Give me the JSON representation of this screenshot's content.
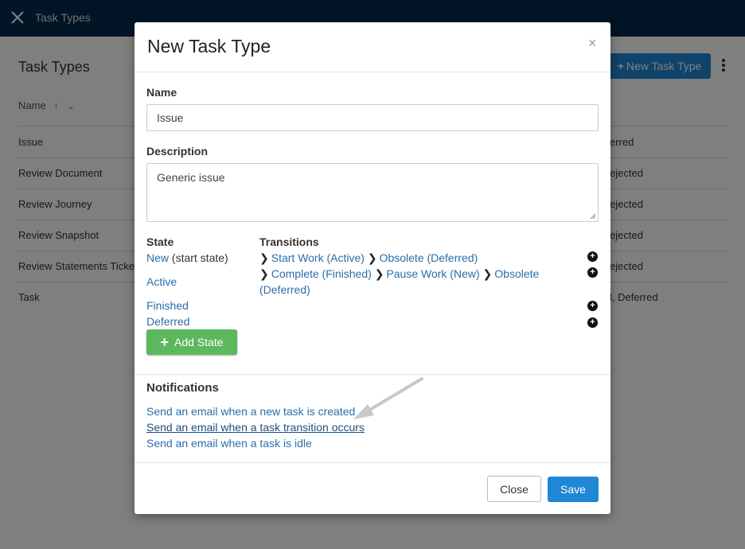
{
  "app": {
    "title": "Task Types",
    "page_title": "Task Types",
    "new_button_label": "New Task Type",
    "column_name": "Name",
    "rows": [
      {
        "name": "Issue",
        "right": "erred"
      },
      {
        "name": "Review Document",
        "right": "ejected"
      },
      {
        "name": "Review Journey",
        "right": "ejected"
      },
      {
        "name": "Review Snapshot",
        "right": "ejected"
      },
      {
        "name": "Review Statements Ticket",
        "right": "ejected"
      },
      {
        "name": "Task",
        "right": "l, Deferred"
      }
    ]
  },
  "modal": {
    "title": "New Task Type",
    "close_glyph": "×",
    "name_label": "Name",
    "name_value": "Issue",
    "description_label": "Description",
    "description_value": "Generic issue",
    "state_label": "State",
    "transitions_label": "Transitions",
    "states": [
      {
        "name": "New",
        "suffix": "(start state)"
      },
      {
        "name": "Active",
        "suffix": ""
      },
      {
        "name": "Finished",
        "suffix": ""
      },
      {
        "name": "Deferred",
        "suffix": ""
      }
    ],
    "transitions": {
      "new": [
        {
          "label": "Start Work (Active)"
        },
        {
          "label": "Obsolete (Deferred)"
        }
      ],
      "active": [
        {
          "label": "Complete (Finished)"
        },
        {
          "label": "Pause Work (New)"
        },
        {
          "label": "Obsolete"
        }
      ],
      "active_wrap": "(Deferred)"
    },
    "add_state_label": "Add State",
    "notifications_label": "Notifications",
    "notifications": [
      "Send an email when a new task is created",
      "Send an email when a task transition occurs",
      "Send an email when a task is idle"
    ],
    "close_button_label": "Close",
    "save_button_label": "Save"
  },
  "colors": {
    "topbar": "#022a4c",
    "primary": "#1f87d6",
    "success": "#5cb85c",
    "link": "#2a6ea8"
  }
}
